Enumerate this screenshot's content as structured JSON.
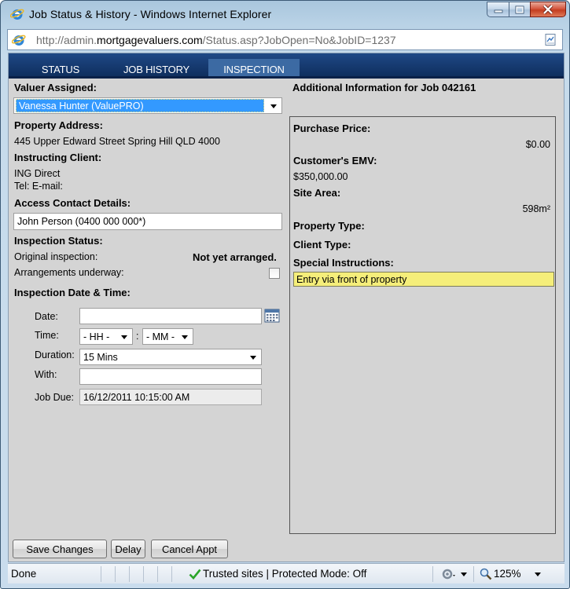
{
  "window": {
    "title": "Job Status & History - Windows Internet Explorer"
  },
  "address": {
    "prefix": "http://admin.",
    "domain": "mortgagevaluers.com",
    "path": "/Status.asp?JobOpen=No&JobID=1237"
  },
  "tabs": [
    {
      "label": "STATUS"
    },
    {
      "label": "JOB HISTORY"
    },
    {
      "label": "INSPECTION"
    }
  ],
  "left": {
    "valuer_label": "Valuer Assigned:",
    "valuer_value": "Vanessa Hunter (ValuePRO)",
    "property_label": "Property Address:",
    "property_value": "445 Upper Edward Street  Spring Hill QLD 4000",
    "client_label": "Instructing Client:",
    "client_name": "ING Direct",
    "client_contact": "Tel:  E-mail:",
    "access_label": "Access Contact Details:",
    "access_value": "John Person (0400 000 000*)",
    "status_label": "Inspection Status:",
    "original_label": "Original inspection:",
    "original_value": "Not yet arranged.",
    "arrangements_label": "Arrangements underway:",
    "datetime_label": "Inspection Date & Time:",
    "date_label": "Date:",
    "date_value": "",
    "time_label": "Time:",
    "hour_value": "- HH -",
    "colon": ":",
    "minute_value": "- MM -",
    "duration_label": "Duration:",
    "duration_value": "15 Mins",
    "with_label": "With:",
    "with_value": "",
    "due_label": "Job Due:",
    "due_value": "16/12/2011 10:15:00 AM"
  },
  "right": {
    "heading": "Additional Information for Job 042161",
    "purchase_label": "Purchase Price:",
    "purchase_value": "$0.00",
    "emv_label": "Customer's EMV:",
    "emv_value": "$350,000.00",
    "site_label": "Site Area:",
    "site_value": "598m²",
    "ptype_label": "Property Type:",
    "ctype_label": "Client Type:",
    "special_label": "Special Instructions:",
    "special_value": "Entry via front of property"
  },
  "buttons": {
    "save": "Save Changes",
    "delay": "Delay",
    "cancel": "Cancel Appt"
  },
  "statusbar": {
    "done": "Done",
    "zone": "Trusted sites | Protected Mode: Off",
    "zoom": "125%"
  },
  "icons": {
    "window": "internet-explorer-icon",
    "address": "internet-explorer-icon",
    "address_right": "compatibility-view-icon",
    "calendar": "calendar-icon",
    "zone": "checkmark-icon",
    "zoom": "magnifier-icon"
  },
  "colors": {
    "tabbar": "#163a70",
    "active_tab": "#3c6aa3",
    "selection": "#3399ff",
    "special_highlight": "#f5ee7a",
    "close_button": "#c33d20",
    "trusted_check": "#2aa52a"
  }
}
